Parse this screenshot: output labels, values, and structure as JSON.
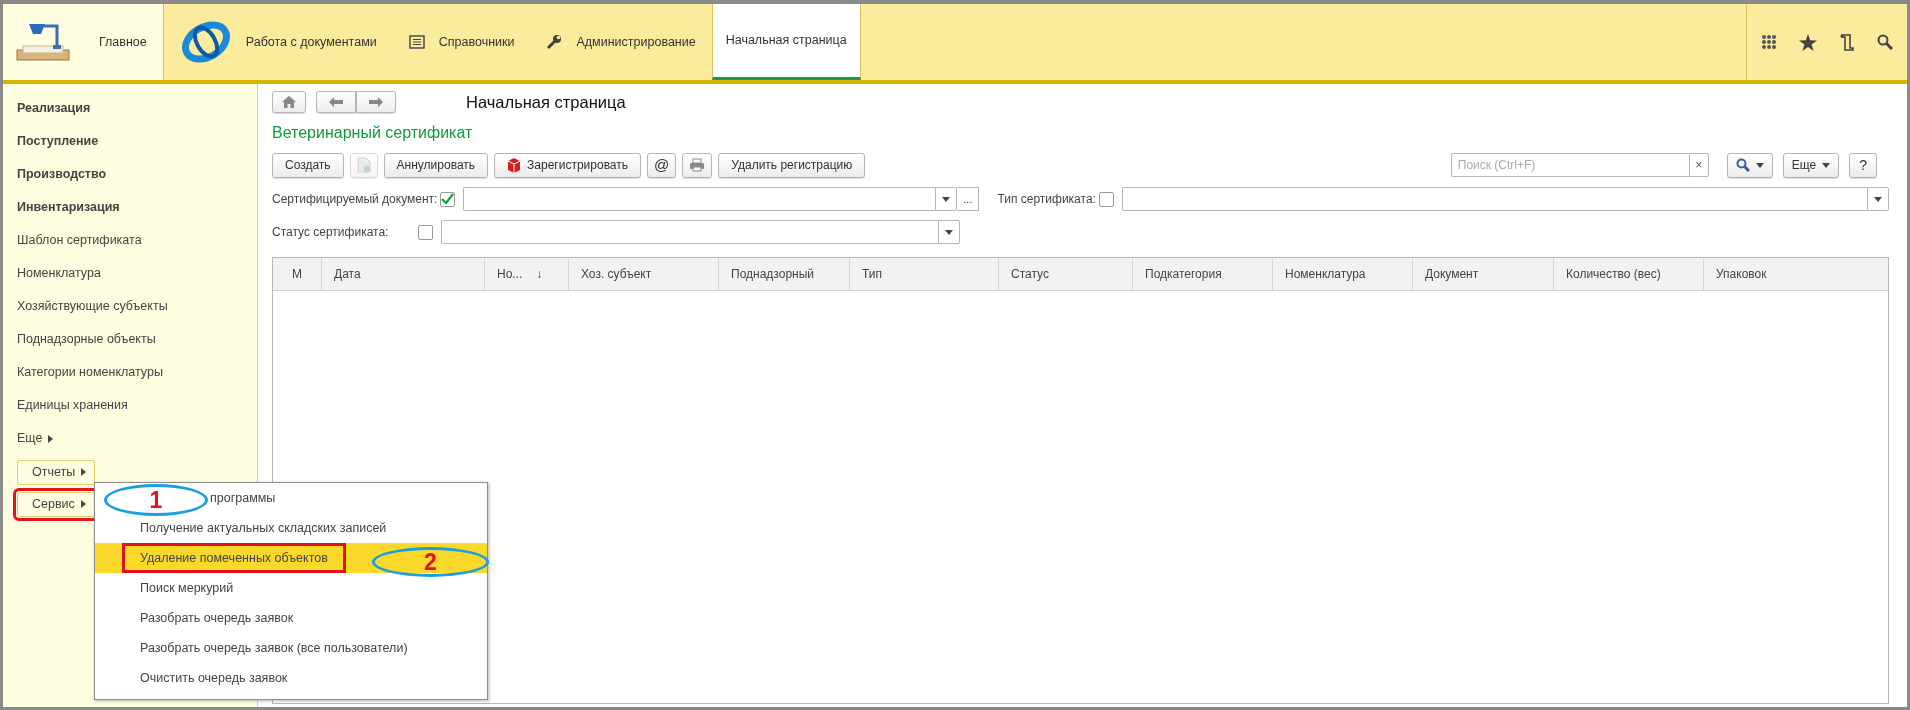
{
  "top_nav": {
    "sections": [
      {
        "kind": "home",
        "label": "Главное",
        "selected": true
      },
      {
        "kind": "documents",
        "label": "Работа с документами",
        "selected": false
      },
      {
        "kind": "catalogs",
        "label": "Справочники",
        "selected": false
      },
      {
        "kind": "admin",
        "label": "Администрирование",
        "selected": false
      }
    ],
    "open_tabs": [
      {
        "label": "Начальная страница",
        "selected": true
      }
    ]
  },
  "sidebar": {
    "items": [
      {
        "kind": "group",
        "label": "Реализация"
      },
      {
        "kind": "group",
        "label": "Поступление"
      },
      {
        "kind": "group",
        "label": "Производство"
      },
      {
        "kind": "group",
        "label": "Инвентаризация"
      },
      {
        "kind": "command",
        "label": "Шаблон сертификата"
      },
      {
        "kind": "command",
        "label": "Номенклатура"
      },
      {
        "kind": "command",
        "label": "Хозяйствующие субъекты"
      },
      {
        "kind": "command",
        "label": "Поднадзорные объекты"
      },
      {
        "kind": "command",
        "label": "Категории номенклатуры"
      },
      {
        "kind": "command",
        "label": "Единицы хранения"
      }
    ],
    "more": {
      "label": "Еще"
    },
    "buttons": [
      {
        "label": "Отчеты",
        "outlined": false
      },
      {
        "label": "Сервис",
        "outlined": true
      }
    ]
  },
  "popup_menu": {
    "items": [
      {
        "label": "программы",
        "selected": false,
        "outlined": false
      },
      {
        "label": "Получение актуальных складских записей",
        "selected": false,
        "outlined": false
      },
      {
        "label": "Удаление помеченных объектов",
        "selected": true,
        "outlined": true
      },
      {
        "label": "Поиск меркурий",
        "selected": false,
        "outlined": false
      },
      {
        "label": "Разобрать очередь заявок",
        "selected": false,
        "outlined": false
      },
      {
        "label": "Разобрать очередь заявок (все пользователи)",
        "selected": false,
        "outlined": false
      },
      {
        "label": "Очистить очередь заявок",
        "selected": false,
        "outlined": false
      }
    ]
  },
  "callouts": [
    {
      "number": "1"
    },
    {
      "number": "2"
    }
  ],
  "page_title": "Начальная страница",
  "form": {
    "title": "Ветеринарный сертификат",
    "toolbar": [
      {
        "kind": "text",
        "label": "Создать",
        "disabled": false
      },
      {
        "kind": "document",
        "disabled": true
      },
      {
        "kind": "text",
        "label": "Аннулировать",
        "disabled": false
      },
      {
        "kind": "register",
        "label": "Зарегистрировать",
        "disabled": false
      },
      {
        "kind": "text",
        "label": "@",
        "disabled": false
      },
      {
        "kind": "print",
        "disabled": false
      },
      {
        "kind": "text",
        "label": "Удалить регистрацию",
        "disabled": false
      }
    ],
    "search": {
      "placeholder": "Поиск (Ctrl+F)",
      "clear": "×"
    },
    "more_button": "Еще",
    "help_button": "?",
    "filter_rows": [
      [
        {
          "label": "Сертифицируемый документ:",
          "checked": true,
          "choose_button": "..."
        },
        {
          "label": "Тип сертификата:",
          "checked": false
        }
      ],
      [
        {
          "label": "Статус сертификата:",
          "checked": false
        }
      ]
    ],
    "table": {
      "columns": [
        {
          "label": "М"
        },
        {
          "label": "Дата"
        },
        {
          "label": "Но...",
          "sort_mark": "↓"
        },
        {
          "label": "Хоз. субъект"
        },
        {
          "label": "Поднадзорный"
        },
        {
          "label": "Тип"
        },
        {
          "label": "Статус"
        },
        {
          "label": "Подкатегория"
        },
        {
          "label": "Номенклатура"
        },
        {
          "label": "Документ"
        },
        {
          "label": "Количество (вес)"
        },
        {
          "label": "Упаковок"
        }
      ]
    }
  }
}
